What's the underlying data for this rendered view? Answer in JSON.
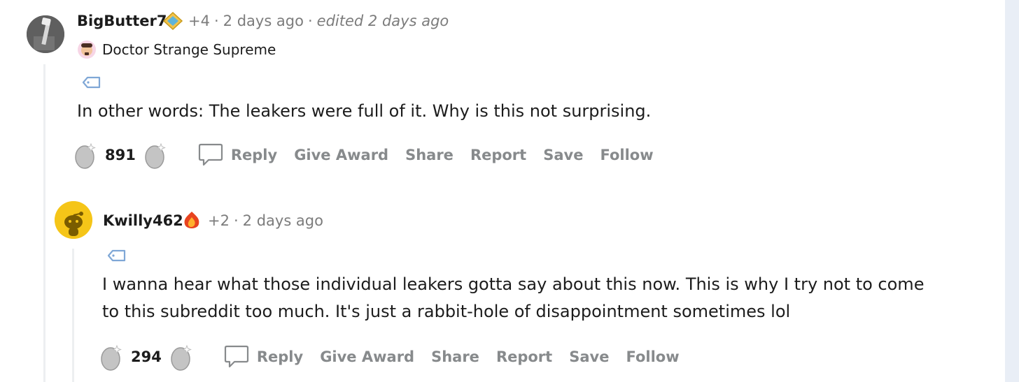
{
  "comments": [
    {
      "username": "BigButter7",
      "karma": "+4",
      "time": "2 days ago",
      "edited": "edited 2 days ago",
      "flair": "Doctor Strange Supreme",
      "body": "In other words: The leakers were full of it. Why is this not surprising.",
      "score": "891",
      "actions": {
        "reply": "Reply",
        "give_award": "Give Award",
        "share": "Share",
        "report": "Report",
        "save": "Save",
        "follow": "Follow"
      }
    },
    {
      "username": "Kwilly462",
      "karma": "+2",
      "time": "2 days ago",
      "body": "I wanna hear what those individual leakers gotta say about this now. This is why I try not to come to this subreddit too much. It's just a rabbit-hole of disappointment sometimes lol",
      "score": "294",
      "actions": {
        "reply": "Reply",
        "give_award": "Give Award",
        "share": "Share",
        "report": "Report",
        "save": "Save",
        "follow": "Follow"
      }
    }
  ],
  "colors": {
    "text": "#1c1c1c",
    "meta": "#7c7c7c",
    "action": "#878a8c",
    "thread": "#edeff1",
    "yellow_avatar": "#f5c518"
  }
}
